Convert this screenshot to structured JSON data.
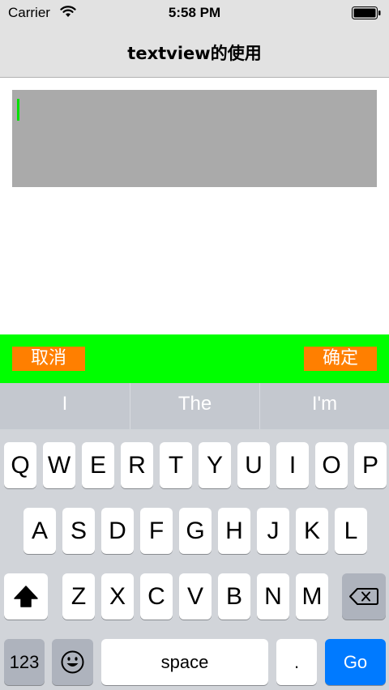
{
  "status_bar": {
    "carrier": "Carrier",
    "time": "5:58 PM",
    "wifi_icon": "wifi-icon",
    "battery_icon": "battery-icon"
  },
  "nav": {
    "title": "textview的使用"
  },
  "textview": {
    "value": "",
    "background": "#aaaaaa",
    "caret_color": "#00e000"
  },
  "toolbar": {
    "background": "#00ff00",
    "button_color": "#ff7f00",
    "cancel_label": "取消",
    "confirm_label": "确定"
  },
  "keyboard": {
    "suggestions": [
      "I",
      "The",
      "I'm"
    ],
    "row1": [
      "Q",
      "W",
      "E",
      "R",
      "T",
      "Y",
      "U",
      "I",
      "O",
      "P"
    ],
    "row2": [
      "A",
      "S",
      "D",
      "F",
      "G",
      "H",
      "J",
      "K",
      "L"
    ],
    "row3": [
      "Z",
      "X",
      "C",
      "V",
      "B",
      "N",
      "M"
    ],
    "numbers_label": "123",
    "space_label": "space",
    "period_label": ".",
    "go_label": "Go",
    "shift_icon": "shift-icon",
    "backspace_icon": "backspace-icon",
    "emoji_icon": "emoji-icon"
  }
}
